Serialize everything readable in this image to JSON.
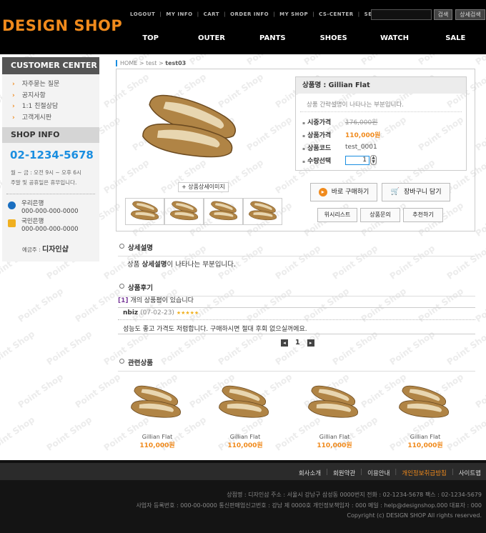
{
  "header": {
    "logo": "DESIGN SHOP",
    "top_links": [
      "LOGOUT",
      "MY INFO",
      "CART",
      "ORDER INFO",
      "MY SHOP",
      "CS-CENTER",
      "SEARCH"
    ],
    "search_btn": "검색",
    "detail_search_btn": "상세검색",
    "main_nav": [
      "TOP",
      "OUTER",
      "PANTS",
      "SHOES",
      "WATCH",
      "SALE"
    ]
  },
  "sidebar": {
    "cc_title": "CUSTOMER CENTER",
    "cc_items": [
      "자주묻는 질문",
      "공지사항",
      "1:1 친절상담",
      "고객게시판"
    ],
    "shop_title": "SHOP INFO",
    "phone": "02-1234-5678",
    "hours1": "월 ~ 금 : 오전 9시 ~ 오후 6시",
    "hours2": "주말 및 공휴일은 휴무입니다.",
    "bank1_name": "우리은행",
    "bank1_acct": "000-000-000-0000",
    "bank2_name": "국민은행",
    "bank2_acct": "000-000-000-0000",
    "holder_label": "예금주 :",
    "holder_name": "디자인샵"
  },
  "breadcrumb": {
    "home": "HOME",
    "sep": ">",
    "cat": "test",
    "cur": "test03"
  },
  "product": {
    "title_label": "상품명 :",
    "name": "Gillian Flat",
    "desc": "상품 간략설명이 나타나는 부분입니다.",
    "retail_label": "시중가격",
    "retail": "176,000원",
    "price_label": "상품가격",
    "price": "110,000원",
    "code_label": "상품코드",
    "code": "test_0001",
    "qty_label": "수량선택",
    "qty": "1",
    "zoom_btn": "+ 상품상세이미지",
    "buy_btn": "바로 구매하기",
    "cart_btn": "장바구니 담기",
    "wish_btn": "위시리스트",
    "qna_btn": "상품문의",
    "rec_btn": "추천하기"
  },
  "detail": {
    "title": "상세설명",
    "text_pre": "상품 ",
    "text_bold": "상세설명",
    "text_post": "이 나타나는 부분입니다."
  },
  "reviews": {
    "title": "상품후기",
    "count": "[1]",
    "count_text": "개의 상품평이 있습니다",
    "author": "nbiz",
    "date": "(07-02-23)",
    "stars": "★★★★★",
    "text": "성능도 좋고 가격도 저렴합니다. 구매하시면 절대 후회 없으실꺼에요.",
    "page": "1"
  },
  "related": {
    "title": "관련상품",
    "items": [
      {
        "name": "Gillian Flat",
        "price": "110,000원"
      },
      {
        "name": "Gillian Flat",
        "price": "110,000원"
      },
      {
        "name": "Gillian Flat",
        "price": "110,000원"
      },
      {
        "name": "Gillian Flat",
        "price": "110,000원"
      }
    ]
  },
  "footer": {
    "links": [
      "회사소개",
      "회원약관",
      "이용안내",
      "개인정보취급방침",
      "사이트맵"
    ],
    "line1": "상점명 : 디자인샵   주소 : 서울시 강남구 삼성동 0000번지   전화 : 02-1234-5678   팩스 : 02-1234-5679",
    "line2": "사업자 등록번호 : 000-00-0000   통신판매업신고번호 : 강남 제 0000호 개인정보책임자 : 000   메일 : help@designshop.000   대표자 : 000",
    "line3": "Copyright (c) DESIGN SHOP All rights reserved."
  },
  "watermark": "Point Shop",
  "colors": {
    "accent": "#f08a1c",
    "blue": "#1a8ee0",
    "shoe": "#b08445"
  }
}
